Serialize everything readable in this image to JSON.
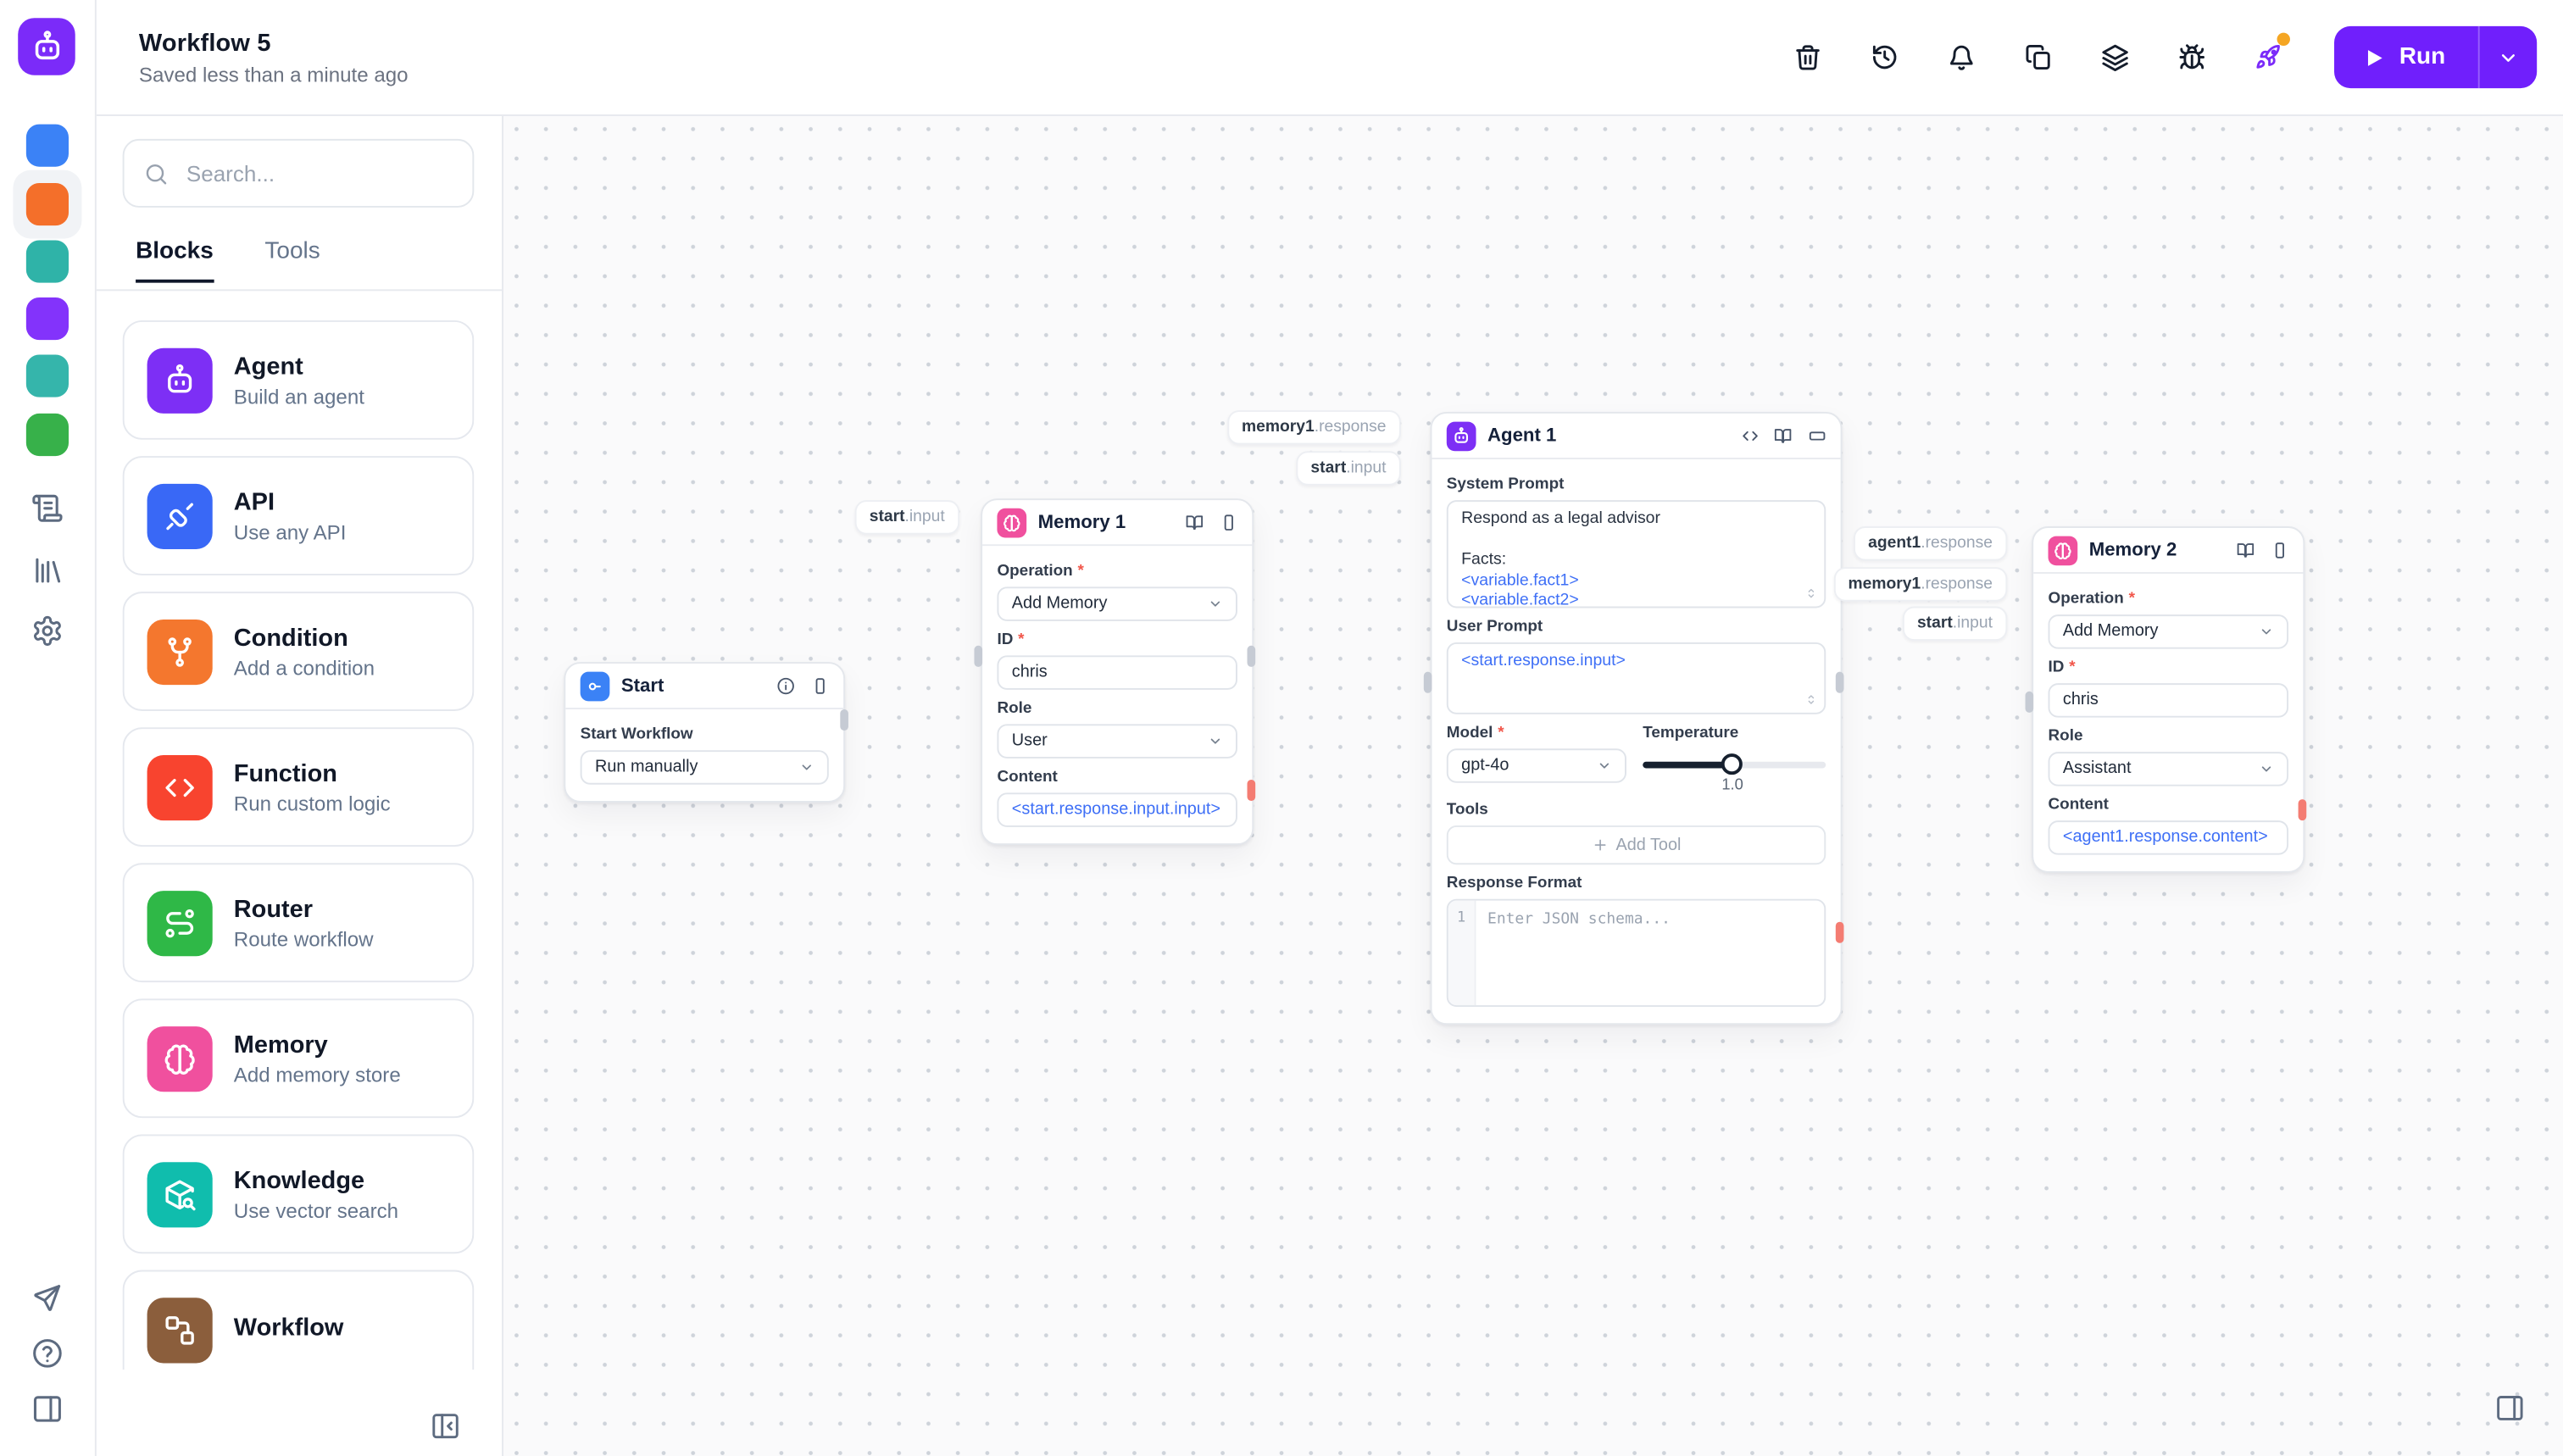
{
  "colors": {
    "accent_purple": "#701ffc",
    "run_button_purple": "#701ffc",
    "logo_purple": "#7b2bf9",
    "notification_dot_orange": "#f5a623",
    "error_port_red": "#f47c72",
    "token_blue": "#3e6ff6",
    "rail_blue": "#3b82f6",
    "rail_orange": "#f46f2a",
    "rail_teal": "#2fb3a8",
    "rail_purple": "#8333fb",
    "rail_teal2": "#35b5ab",
    "rail_green": "#37b14a",
    "block_agent": "#7d2ff5",
    "block_api": "#3968f6",
    "block_condition": "#f4772e",
    "block_function": "#f8442f",
    "block_router": "#2fb847",
    "block_memory": "#f0509e",
    "block_knowledge": "#10bdad",
    "block_workflow": "#8b5e3c",
    "start_blue": "#3b82f6"
  },
  "topbar": {
    "title": "Workflow 5",
    "subtitle": "Saved less than a minute ago",
    "run_label": "Run"
  },
  "sidebar": {
    "search_placeholder": "Search...",
    "tabs": {
      "blocks": "Blocks",
      "tools": "Tools"
    },
    "blocks": [
      {
        "name": "Agent",
        "desc": "Build an agent"
      },
      {
        "name": "API",
        "desc": "Use any API"
      },
      {
        "name": "Condition",
        "desc": "Add a condition"
      },
      {
        "name": "Function",
        "desc": "Run custom logic"
      },
      {
        "name": "Router",
        "desc": "Route workflow"
      },
      {
        "name": "Memory",
        "desc": "Add memory store"
      },
      {
        "name": "Knowledge",
        "desc": "Use vector search"
      },
      {
        "name": "Workflow",
        "desc": ""
      }
    ]
  },
  "ui": {
    "required": "*"
  },
  "canvas": {
    "start": {
      "title": "Start",
      "workflow_label": "Start Workflow",
      "mode_value": "Run manually"
    },
    "memory1": {
      "title": "Memory 1",
      "operation_label": "Operation",
      "operation_value": "Add Memory",
      "id_label": "ID",
      "id_value": "chris",
      "role_label": "Role",
      "role_value": "User",
      "content_label": "Content",
      "content_value": "<start.response.input.input>"
    },
    "agent1": {
      "title": "Agent 1",
      "system_prompt_label": "System Prompt",
      "sp_line1": "Respond as a legal advisor",
      "sp_line2": "Facts:",
      "sp_token1": "<variable.fact1>",
      "sp_token2": "<variable.fact2>",
      "user_prompt_label": "User Prompt",
      "user_prompt_value": "<start.response.input>",
      "model_label": "Model",
      "model_value": "gpt-4o",
      "temperature_label": "Temperature",
      "temperature_value": "1.0",
      "tools_label": "Tools",
      "add_tool_label": "Add Tool",
      "response_format_label": "Response Format",
      "response_format_line_number": "1",
      "response_format_placeholder": "Enter JSON schema..."
    },
    "memory2": {
      "title": "Memory 2",
      "operation_label": "Operation",
      "operation_value": "Add Memory",
      "id_label": "ID",
      "id_value": "chris",
      "role_label": "Role",
      "role_value": "Assistant",
      "content_label": "Content",
      "content_value": "<agent1.response.content>"
    },
    "edge_labels": [
      {
        "source": "start",
        "path": ".input"
      },
      {
        "source": "memory1",
        "path": ".response"
      },
      {
        "source": "start",
        "path": ".input"
      },
      {
        "source": "agent1",
        "path": ".response"
      },
      {
        "source": "memory1",
        "path": ".response"
      },
      {
        "source": "start",
        "path": ".input"
      }
    ]
  }
}
